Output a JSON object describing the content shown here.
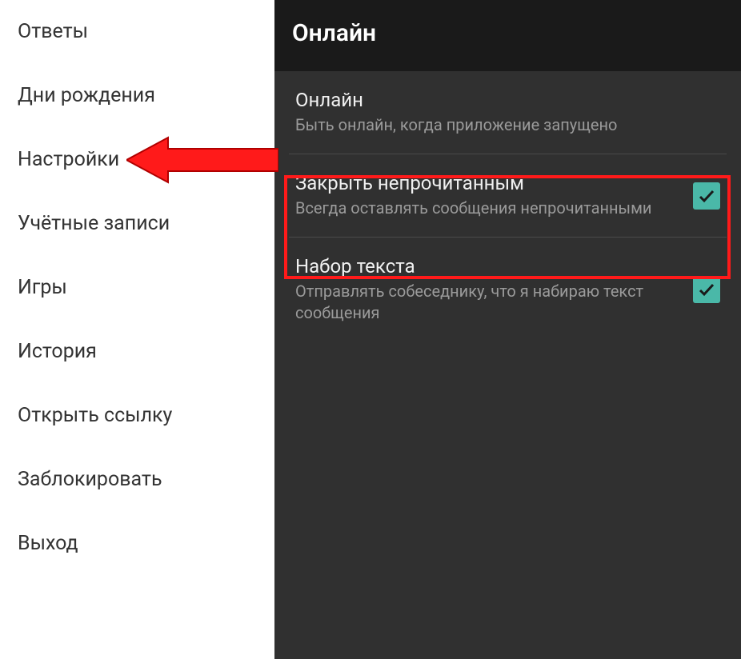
{
  "sidebar": {
    "items": [
      {
        "label": "Ответы"
      },
      {
        "label": "Дни рождения"
      },
      {
        "label": "Настройки"
      },
      {
        "label": "Учётные записи"
      },
      {
        "label": "Игры"
      },
      {
        "label": "История"
      },
      {
        "label": "Открыть ссылку"
      },
      {
        "label": "Заблокировать"
      },
      {
        "label": "Выход"
      }
    ]
  },
  "main": {
    "title": "Онлайн",
    "settings": [
      {
        "title": "Онлайн",
        "desc": "Быть онлайн, когда приложение запущено",
        "checked": false
      },
      {
        "title": "Закрыть непрочитанным",
        "desc": "Всегда оставлять сообщения непрочитанными",
        "checked": true
      },
      {
        "title": "Набор текста",
        "desc": "Отправлять собеседнику, что я набираю текст сообщения",
        "checked": true
      }
    ]
  },
  "colors": {
    "accent": "#4ab8a8",
    "highlight": "#ff1a1a"
  }
}
